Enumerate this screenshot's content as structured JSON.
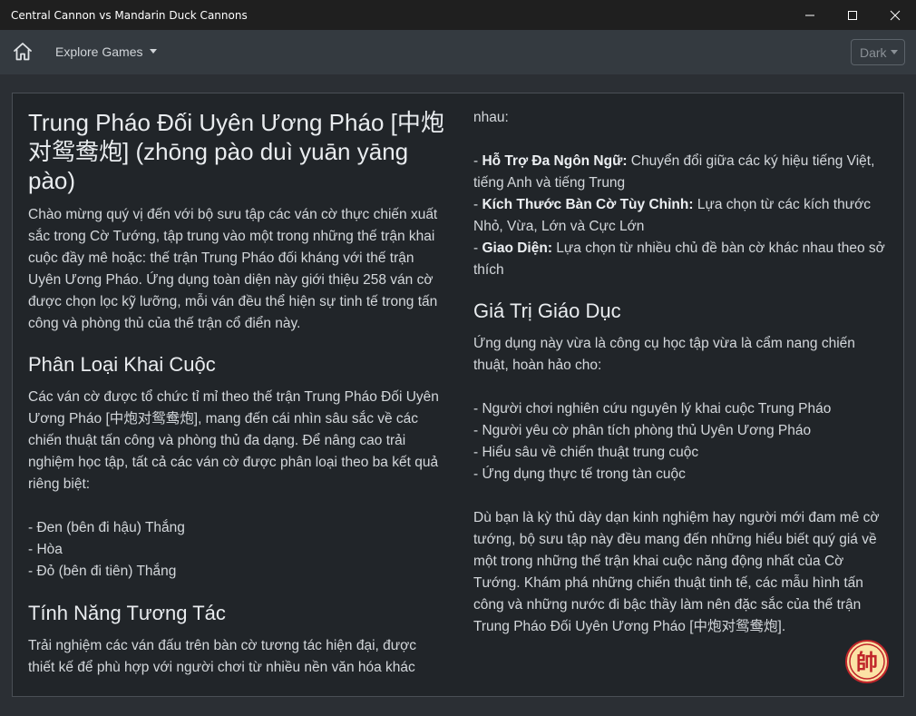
{
  "window": {
    "title": "Central Cannon vs Mandarin Duck Cannons"
  },
  "nav": {
    "home_icon": "home-icon",
    "explore_label": "Explore Games",
    "theme_label": "Dark"
  },
  "content": {
    "main_title": "Trung Pháo Đối Uyên Ương Pháo [中炮对鸳鸯炮] (zhōng pào duì yuān yāng pào)",
    "intro": "Chào mừng quý vị đến với bộ sưu tập các ván cờ thực chiến xuất sắc trong Cờ Tướng, tập trung vào một trong những thế trận khai cuộc đầy mê hoặc: thế trận Trung Pháo đối kháng với thế trận Uyên Ương Pháo. Ứng dụng toàn diện này giới thiệu 258 ván cờ được chọn lọc kỹ lưỡng, mỗi ván đều thể hiện sự tinh tế trong tấn công và phòng thủ của thế trận cổ điển này.",
    "classification_heading": "Phân Loại Khai Cuộc",
    "classification_text": "Các ván cờ được tổ chức tỉ mỉ theo thế trận Trung Pháo Đối Uyên Ương Pháo [中炮对鸳鸯炮], mang đến cái nhìn sâu sắc về các chiến thuật tấn công và phòng thủ đa dạng. Để nâng cao trải nghiệm học tập, tất cả các ván cờ được phân loại theo ba kết quả riêng biệt:",
    "results": [
      "- Đen (bên đi hậu) Thắng",
      "- Hòa",
      "- Đỏ (bên đi tiên) Thắng"
    ],
    "features_heading": "Tính Năng Tương Tác",
    "features_text": "Trải nghiệm các ván đấu trên bàn cờ tương tác hiện đại, được thiết kế để phù hợp với người chơi từ nhiều nền văn hóa khác nhau:",
    "features": [
      {
        "label": "Hỗ Trợ Đa Ngôn Ngữ:",
        "text": " Chuyển đổi giữa các ký hiệu tiếng Việt, tiếng Anh và tiếng Trung"
      },
      {
        "label": "Kích Thước Bàn Cờ Tùy Chỉnh:",
        "text": " Lựa chọn từ các kích thước Nhỏ, Vừa, Lớn và Cực Lớn"
      },
      {
        "label": "Giao Diện:",
        "text": " Lựa chọn từ nhiều chủ đề bàn cờ khác nhau theo sở thích"
      }
    ],
    "education_heading": "Giá Trị Giáo Dục",
    "education_text": "Ứng dụng này vừa là công cụ học tập vừa là cẩm nang chiến thuật, hoàn hảo cho:",
    "education_items": [
      "- Người chơi nghiên cứu nguyên lý khai cuộc Trung Pháo",
      "- Người yêu cờ phân tích phòng thủ Uyên Ương Pháo",
      "- Hiểu sâu về chiến thuật trung cuộc",
      "- Ứng dụng thực tế trong tàn cuộc"
    ],
    "closing": "Dù bạn là kỳ thủ dày dạn kinh nghiệm hay người mới đam mê cờ tướng, bộ sưu tập này đều mang đến những hiểu biết quý giá về một trong những thế trận khai cuộc năng động nhất của Cờ Tướng. Khám phá những chiến thuật tinh tế, các mẫu hình tấn công và những nước đi bậc thầy làm nên đặc sắc của thế trận Trung Pháo Đối Uyên Ương Pháo [中炮对鸳鸯炮]."
  },
  "seal": {
    "icon": "xiangqi-general-piece-icon",
    "glyph": "帥",
    "color": "#c0262b"
  }
}
